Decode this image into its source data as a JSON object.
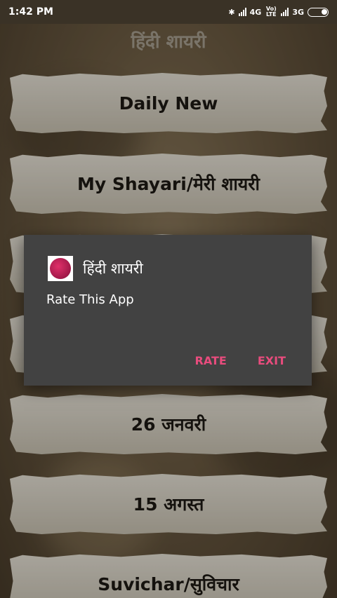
{
  "status_bar": {
    "time": "1:42 PM",
    "network_1": "4G",
    "volte": "Vo) LTE",
    "network_2": "3G",
    "icons": [
      "bluetooth-icon",
      "signal-icon",
      "battery-icon"
    ]
  },
  "app": {
    "title": "हिंदी शायरी"
  },
  "menu": {
    "items": [
      {
        "label": "Daily New"
      },
      {
        "label": "My Shayari/मेरी शायरी"
      },
      {
        "label": ""
      },
      {
        "label": ""
      },
      {
        "label": "26 जनवरी"
      },
      {
        "label": "15 अगस्त"
      },
      {
        "label": "Suvichar/सुविचार"
      }
    ]
  },
  "dialog": {
    "title": "हिंदी शायरी",
    "message": "Rate This App",
    "rate_label": "RATE",
    "exit_label": "EXIT",
    "icon": "app-logo-icon"
  },
  "colors": {
    "accent": "#e84c7d",
    "dialog_bg": "#424242",
    "paper": "#e0dbcf"
  }
}
